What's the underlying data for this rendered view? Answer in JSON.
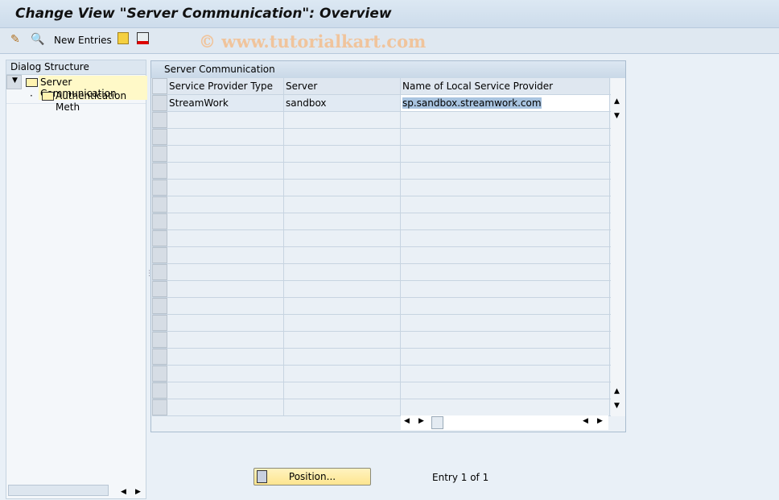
{
  "title": "Change View \"Server Communication\": Overview",
  "toolbar": {
    "new_entries": "New Entries",
    "watermark": "© www.tutorialkart.com"
  },
  "dialog": {
    "header": "Dialog Structure",
    "items": [
      {
        "label": "Server Communication"
      },
      {
        "label": "Authentication Meth"
      }
    ]
  },
  "table": {
    "title": "Server Communication",
    "columns": [
      "Service Provider Type",
      "Server",
      "Name of Local Service Provider"
    ],
    "rows": [
      [
        "StreamWork",
        "sandbox",
        "sp.sandbox.streamwork.com"
      ]
    ]
  },
  "footer": {
    "position": "Position...",
    "entry": "Entry 1 of 1"
  }
}
